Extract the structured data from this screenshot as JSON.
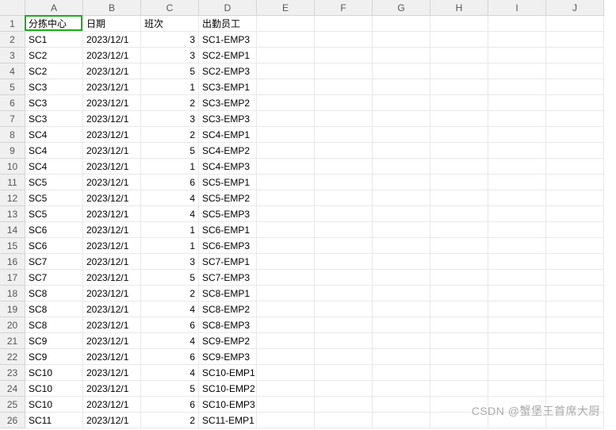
{
  "active_cell": {
    "row": 1,
    "col": "A"
  },
  "columns": [
    "A",
    "B",
    "C",
    "D",
    "E",
    "F",
    "G",
    "H",
    "I",
    "J"
  ],
  "headers": {
    "A": "分拣中心",
    "B": "日期",
    "C": "班次",
    "D": "出勤员工"
  },
  "rows": [
    {
      "A": "SC1",
      "B": "2023/12/1",
      "C": "3",
      "D": "SC1-EMP3"
    },
    {
      "A": "SC2",
      "B": "2023/12/1",
      "C": "3",
      "D": "SC2-EMP1"
    },
    {
      "A": "SC2",
      "B": "2023/12/1",
      "C": "5",
      "D": "SC2-EMP3"
    },
    {
      "A": "SC3",
      "B": "2023/12/1",
      "C": "1",
      "D": "SC3-EMP1"
    },
    {
      "A": "SC3",
      "B": "2023/12/1",
      "C": "2",
      "D": "SC3-EMP2"
    },
    {
      "A": "SC3",
      "B": "2023/12/1",
      "C": "3",
      "D": "SC3-EMP3"
    },
    {
      "A": "SC4",
      "B": "2023/12/1",
      "C": "2",
      "D": "SC4-EMP1"
    },
    {
      "A": "SC4",
      "B": "2023/12/1",
      "C": "5",
      "D": "SC4-EMP2"
    },
    {
      "A": "SC4",
      "B": "2023/12/1",
      "C": "1",
      "D": "SC4-EMP3"
    },
    {
      "A": "SC5",
      "B": "2023/12/1",
      "C": "6",
      "D": "SC5-EMP1"
    },
    {
      "A": "SC5",
      "B": "2023/12/1",
      "C": "4",
      "D": "SC5-EMP2"
    },
    {
      "A": "SC5",
      "B": "2023/12/1",
      "C": "4",
      "D": "SC5-EMP3"
    },
    {
      "A": "SC6",
      "B": "2023/12/1",
      "C": "1",
      "D": "SC6-EMP1"
    },
    {
      "A": "SC6",
      "B": "2023/12/1",
      "C": "1",
      "D": "SC6-EMP3"
    },
    {
      "A": "SC7",
      "B": "2023/12/1",
      "C": "3",
      "D": "SC7-EMP1"
    },
    {
      "A": "SC7",
      "B": "2023/12/1",
      "C": "5",
      "D": "SC7-EMP3"
    },
    {
      "A": "SC8",
      "B": "2023/12/1",
      "C": "2",
      "D": "SC8-EMP1"
    },
    {
      "A": "SC8",
      "B": "2023/12/1",
      "C": "4",
      "D": "SC8-EMP2"
    },
    {
      "A": "SC8",
      "B": "2023/12/1",
      "C": "6",
      "D": "SC8-EMP3"
    },
    {
      "A": "SC9",
      "B": "2023/12/1",
      "C": "4",
      "D": "SC9-EMP2"
    },
    {
      "A": "SC9",
      "B": "2023/12/1",
      "C": "6",
      "D": "SC9-EMP3"
    },
    {
      "A": "SC10",
      "B": "2023/12/1",
      "C": "4",
      "D": "SC10-EMP1"
    },
    {
      "A": "SC10",
      "B": "2023/12/1",
      "C": "5",
      "D": "SC10-EMP2"
    },
    {
      "A": "SC10",
      "B": "2023/12/1",
      "C": "6",
      "D": "SC10-EMP3"
    },
    {
      "A": "SC11",
      "B": "2023/12/1",
      "C": "2",
      "D": "SC11-EMP1"
    }
  ],
  "watermark": "CSDN @蟹堡王首席大厨"
}
